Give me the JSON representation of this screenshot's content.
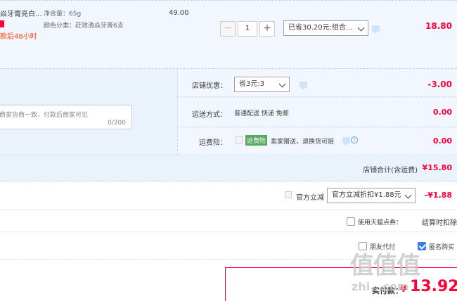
{
  "item": {
    "title": "焱牙膏亮白...",
    "promo_note": "款后48小时",
    "attr_net_label": "净含量：",
    "attr_net_value": "65g",
    "attr_color_label": "颜色分类：",
    "attr_color_value": "荭效清焱牙膏6支",
    "unit_price": "49.00",
    "quantity": "1",
    "qty_minus": "−",
    "qty_plus": "+",
    "discount_select": "已省30.20元:组合...",
    "subtotal": "18.80"
  },
  "shop": {
    "discount_label": "店铺优惠：",
    "discount_select": "省3元:3",
    "discount_amount": "-3.00",
    "message_placeholder": "商家协商一致，付款后商家可见",
    "message_count": "0/200",
    "shipping_label": "运送方式：",
    "shipping_value": "普通配送 快递 免邮",
    "shipping_amount": "0.00",
    "insurance_label": "运费险：",
    "insurance_tag": "运费险",
    "insurance_text": "卖家赠送，退换货可赔",
    "insurance_amount": "0.00",
    "total_label": "店铺合计(含运费)",
    "total_value": "¥15.80"
  },
  "platform": {
    "official_label": "官方立减",
    "official_select": "官方立减折扣¥1.88元",
    "official_amount": "-¥1.88",
    "tmall_points_label": "使用天猫点券：",
    "settle_note": "结算时扣除",
    "friend_pay_label": "朋友代付",
    "anonymous_label": "匿名购买"
  },
  "payment": {
    "label": "实付款：",
    "currency": "¥",
    "amount": "13.92"
  },
  "watermark": {
    "logo": "值值值",
    "text": "zhi...com"
  }
}
